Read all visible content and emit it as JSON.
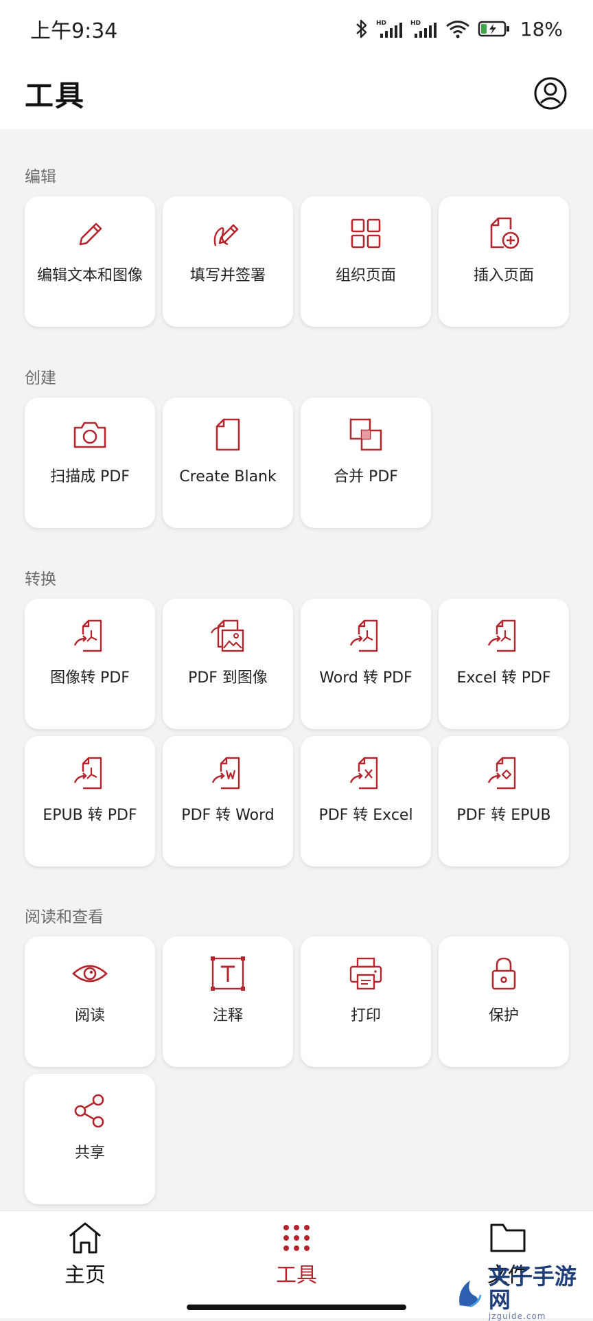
{
  "status": {
    "time": "上午9:34",
    "battery": "18%"
  },
  "header": {
    "title": "工具"
  },
  "sections": {
    "edit": {
      "title": "编辑",
      "items": [
        {
          "label": "编辑文本和图像",
          "icon": "pencil-icon"
        },
        {
          "label": "填写并签署",
          "icon": "sign-pen-icon"
        },
        {
          "label": "组织页面",
          "icon": "grid-icon"
        },
        {
          "label": "插入页面",
          "icon": "insert-page-icon"
        }
      ]
    },
    "create": {
      "title": "创建",
      "items": [
        {
          "label": "扫描成 PDF",
          "icon": "camera-icon"
        },
        {
          "label": "Create Blank",
          "icon": "blank-page-icon"
        },
        {
          "label": "合并 PDF",
          "icon": "merge-icon"
        }
      ]
    },
    "convert": {
      "title": "转换",
      "items": [
        {
          "label": "图像转 PDF",
          "icon": "convert-pdf-icon"
        },
        {
          "label": "PDF 到图像",
          "icon": "pdf-to-image-icon"
        },
        {
          "label": "Word 转 PDF",
          "icon": "convert-pdf-icon"
        },
        {
          "label": "Excel 转 PDF",
          "icon": "convert-pdf-icon"
        },
        {
          "label": "EPUB 转 PDF",
          "icon": "convert-pdf-icon"
        },
        {
          "label": "PDF 转 Word",
          "icon": "convert-word-icon"
        },
        {
          "label": "PDF 转 Excel",
          "icon": "convert-excel-icon"
        },
        {
          "label": "PDF 转 EPUB",
          "icon": "convert-epub-icon"
        }
      ]
    },
    "read": {
      "title": "阅读和查看",
      "items": [
        {
          "label": "阅读",
          "icon": "eye-icon"
        },
        {
          "label": "注释",
          "icon": "text-box-icon"
        },
        {
          "label": "打印",
          "icon": "printer-icon"
        },
        {
          "label": "保护",
          "icon": "lock-icon"
        },
        {
          "label": "共享",
          "icon": "share-icon"
        }
      ]
    }
  },
  "nav": {
    "home": "主页",
    "tools": "工具",
    "files": "文件",
    "active": "tools"
  },
  "watermark": {
    "text": "夹子手游网",
    "sub": "jzguide.com"
  },
  "colors": {
    "accent": "#b3262e",
    "background": "#f3f3f3",
    "card": "#ffffff"
  }
}
